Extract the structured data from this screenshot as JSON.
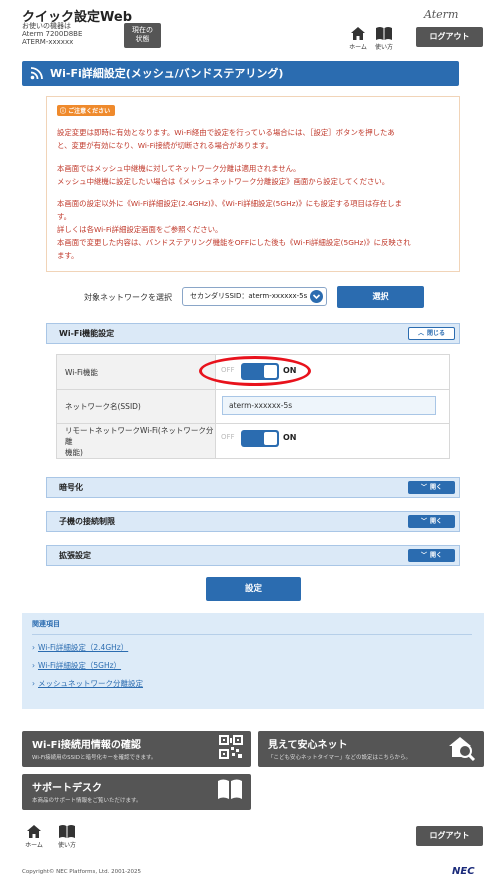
{
  "header": {
    "app_title": "クイック設定Web",
    "model_lines": [
      "お使いの機器は",
      "Aterm 7200D8BE",
      "ATERM-xxxxxx"
    ],
    "status_button": [
      "現在の",
      "状態"
    ],
    "brand": "Aterm",
    "home_label": "ホーム",
    "help_label": "使い方",
    "logout_label": "ログアウト"
  },
  "section": {
    "title": "Wi-Fi詳細設定(メッシュ/バンドステアリング)"
  },
  "notice": {
    "badge": "ご注意ください",
    "lines": [
      "設定変更は即時に有効となります。Wi-Fi経由で設定を行っている場合には、［設定］ボタンを押したあ",
      "と、変更が有効になり、Wi-Fi接続が切断される場合があります。",
      "本画面ではメッシュ中継機に対してネットワーク分離は適用されません。",
      "メッシュ中継機に設定したい場合は《メッシュネットワーク分離設定》画面から設定してください。",
      "本画面の設定以外に《Wi-Fi詳細設定(2.4GHz)》、《Wi-Fi詳細設定(5GHz)》にも設定する項目は存在しま",
      "す。",
      "詳しくは各Wi-Fi詳細設定画面をご参照ください。",
      "本画面で変更した内容は、バンドステアリング機能をOFFにした後も《Wi-Fi詳細設定(5GHz)》に反映され",
      "ます。"
    ]
  },
  "network_select": {
    "label": "対象ネットワークを選択",
    "value": "セカンダリSSID：aterm-xxxxxx-5s",
    "button": "選択"
  },
  "wifi_panel": {
    "title": "Wi-Fi機能設定",
    "close_button": "閉じる",
    "rows": [
      {
        "label": "Wi-Fi機能",
        "off": "OFF",
        "on": "ON"
      },
      {
        "label": "ネットワーク名(SSID)",
        "value": "aterm-xxxxxx-5s"
      },
      {
        "label_line1": "リモートネットワークWi-Fi(ネットワーク分離",
        "label_line2": "機能)",
        "off": "OFF",
        "on": "ON"
      }
    ]
  },
  "collapsed_panels": [
    {
      "title": "暗号化",
      "button": "開く"
    },
    {
      "title": "子機の接続制限",
      "button": "開く"
    },
    {
      "title": "拡張設定",
      "button": "開く"
    }
  ],
  "set_button": "設定",
  "related": {
    "title": "関連項目",
    "links": [
      "Wi-Fi詳細設定（2.4GHz）",
      "Wi-Fi詳細設定（5GHz）",
      "メッシュネットワーク分離設定"
    ]
  },
  "cards": [
    {
      "title": "Wi-Fi接続用情報の確認",
      "subtitle": "Wi-Fi接続用のSSIDと暗号化キーを確認できます。",
      "icon": "qr-code-icon"
    },
    {
      "title": "見えて安心ネット",
      "subtitle": "「こども安心ネットタイマー」などの設定はこちらから。",
      "icon": "home-search-icon"
    },
    {
      "title": "サポートデスク",
      "subtitle": "本商品のサポート情報をご覧いただけます。",
      "icon": "book-icon"
    }
  ],
  "footer": {
    "home_label": "ホーム",
    "help_label": "使い方",
    "logout_label": "ログアウト",
    "copyright": "Copyright© NEC Platforms, Ltd. 2001-2025",
    "logo": "NEC"
  },
  "colors": {
    "primary": "#2b6cb0",
    "panel_bg": "#dbe9f7",
    "notice_text": "#c0392b",
    "highlight": "#e8121c",
    "dark_button": "#555555"
  }
}
